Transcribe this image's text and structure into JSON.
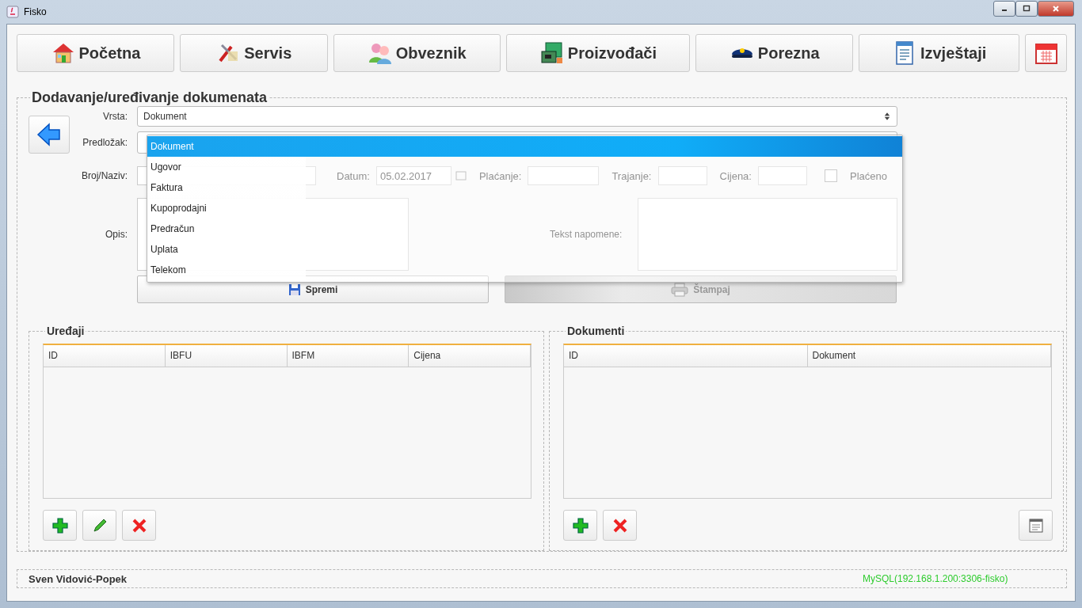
{
  "window": {
    "title": "Fisko"
  },
  "toolbar": [
    {
      "label": "Početna",
      "kind": "home"
    },
    {
      "label": "Servis",
      "kind": "tools"
    },
    {
      "label": "Obveznik",
      "kind": "people"
    },
    {
      "label": "Proizvođači",
      "kind": "board"
    },
    {
      "label": "Porezna",
      "kind": "cap"
    },
    {
      "label": "Izvještaji",
      "kind": "report"
    },
    {
      "kind": "calendar"
    }
  ],
  "form": {
    "title": "Dodavanje/uređivanje dokumenata",
    "vrsta": {
      "label": "Vrsta:",
      "value": "Dokument"
    },
    "predlozak": {
      "label": "Predložak:"
    },
    "broj": {
      "label": "Broj/Naziv:"
    },
    "datum": {
      "label": "Datum:",
      "value": "05.02.2017"
    },
    "placanje": {
      "label": "Plaćanje:"
    },
    "trajanje": {
      "label": "Trajanje:"
    },
    "cijena": {
      "label": "Cijena:"
    },
    "placeno": {
      "label": "Plaćeno",
      "checked": false
    },
    "opis": {
      "label": "Opis:"
    },
    "napomena": {
      "label": "Tekst napomene:"
    },
    "buttons": [
      {
        "label": "Spremi",
        "kind": "save",
        "disabled": false
      },
      {
        "label": "Štampaj",
        "kind": "print",
        "disabled": true
      }
    ]
  },
  "dropdown": {
    "items": [
      {
        "label": "Dokument",
        "selected": true
      },
      {
        "label": "Ugovor",
        "selected": false
      },
      {
        "label": "Faktura",
        "selected": false
      },
      {
        "label": "Kupoprodajni",
        "selected": false
      },
      {
        "label": "Predračun",
        "selected": false
      },
      {
        "label": "Uplata",
        "selected": false
      },
      {
        "label": "Telekom",
        "selected": false
      }
    ]
  },
  "devices": {
    "title": "Uređaji",
    "columns": [
      "ID",
      "IBFU",
      "IBFM",
      "Cijena"
    ],
    "actions": [
      {
        "kind": "add"
      },
      {
        "kind": "edit"
      },
      {
        "kind": "delete"
      }
    ]
  },
  "documents": {
    "title": "Dokumenti",
    "columns": [
      "ID",
      "Dokument"
    ],
    "actions": [
      {
        "kind": "add"
      },
      {
        "kind": "delete"
      },
      {
        "kind": "report"
      }
    ]
  },
  "status_bar": {
    "user": "Sven Vidović-Popek",
    "connection": "MySQL(192.168.1.200:3306-fisko)"
  }
}
